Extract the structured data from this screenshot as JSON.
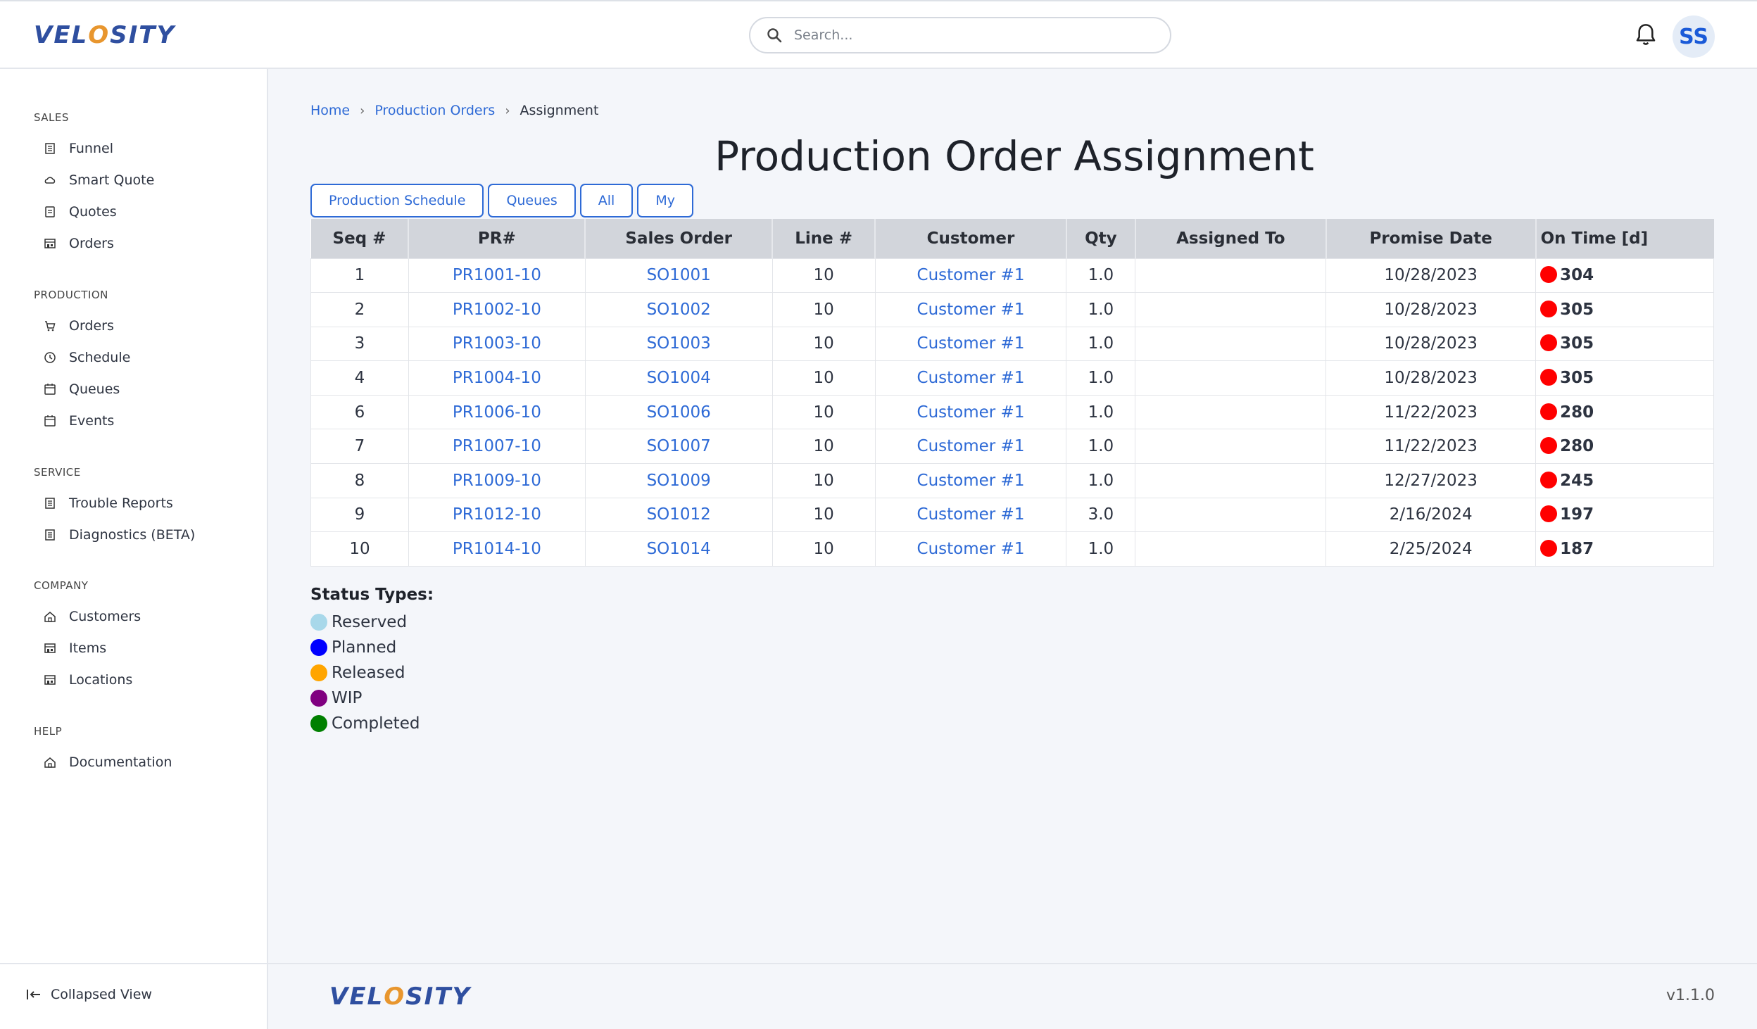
{
  "header": {
    "logo_text_a": "VEL",
    "logo_text_o": "O",
    "logo_text_b": "SITY",
    "search_placeholder": "Search...",
    "avatar_initials": "SS"
  },
  "sidebar": {
    "sections": [
      {
        "title": "SALES",
        "items": [
          {
            "label": "Funnel",
            "icon": "building-icon"
          },
          {
            "label": "Smart Quote",
            "icon": "cloud-icon"
          },
          {
            "label": "Quotes",
            "icon": "document-icon"
          },
          {
            "label": "Orders",
            "icon": "store-icon"
          }
        ]
      },
      {
        "title": "PRODUCTION",
        "items": [
          {
            "label": "Orders",
            "icon": "cart-icon"
          },
          {
            "label": "Schedule",
            "icon": "clock-icon"
          },
          {
            "label": "Queues",
            "icon": "calendar-icon"
          },
          {
            "label": "Events",
            "icon": "calendar-icon"
          }
        ]
      },
      {
        "title": "SERVICE",
        "items": [
          {
            "label": "Trouble Reports",
            "icon": "building-icon"
          },
          {
            "label": "Diagnostics (BETA)",
            "icon": "building-icon"
          }
        ]
      },
      {
        "title": "COMPANY",
        "items": [
          {
            "label": "Customers",
            "icon": "home-icon"
          },
          {
            "label": "Items",
            "icon": "store-icon"
          },
          {
            "label": "Locations",
            "icon": "store-icon"
          }
        ]
      },
      {
        "title": "HELP",
        "items": [
          {
            "label": "Documentation",
            "icon": "home-icon"
          }
        ]
      }
    ],
    "collapse_label": "Collapsed View"
  },
  "breadcrumb": {
    "home": "Home",
    "parent": "Production Orders",
    "current": "Assignment"
  },
  "page_title": "Production Order Assignment",
  "buttons": {
    "schedule": "Production Schedule",
    "queues": "Queues",
    "all": "All",
    "my": "My"
  },
  "table": {
    "headers": [
      "Seq #",
      "PR#",
      "Sales Order",
      "Line #",
      "Customer",
      "Qty",
      "Assigned To",
      "Promise Date",
      "On Time [d]"
    ],
    "rows": [
      {
        "seq": "1",
        "pr": "PR1001-10",
        "so": "SO1001",
        "line": "10",
        "customer": "Customer #1",
        "qty": "1.0",
        "assigned": "",
        "date": "10/28/2023",
        "ontime": "304"
      },
      {
        "seq": "2",
        "pr": "PR1002-10",
        "so": "SO1002",
        "line": "10",
        "customer": "Customer #1",
        "qty": "1.0",
        "assigned": "",
        "date": "10/28/2023",
        "ontime": "305"
      },
      {
        "seq": "3",
        "pr": "PR1003-10",
        "so": "SO1003",
        "line": "10",
        "customer": "Customer #1",
        "qty": "1.0",
        "assigned": "",
        "date": "10/28/2023",
        "ontime": "305"
      },
      {
        "seq": "4",
        "pr": "PR1004-10",
        "so": "SO1004",
        "line": "10",
        "customer": "Customer #1",
        "qty": "1.0",
        "assigned": "",
        "date": "10/28/2023",
        "ontime": "305"
      },
      {
        "seq": "6",
        "pr": "PR1006-10",
        "so": "SO1006",
        "line": "10",
        "customer": "Customer #1",
        "qty": "1.0",
        "assigned": "",
        "date": "11/22/2023",
        "ontime": "280"
      },
      {
        "seq": "7",
        "pr": "PR1007-10",
        "so": "SO1007",
        "line": "10",
        "customer": "Customer #1",
        "qty": "1.0",
        "assigned": "",
        "date": "11/22/2023",
        "ontime": "280"
      },
      {
        "seq": "8",
        "pr": "PR1009-10",
        "so": "SO1009",
        "line": "10",
        "customer": "Customer #1",
        "qty": "1.0",
        "assigned": "",
        "date": "12/27/2023",
        "ontime": "245"
      },
      {
        "seq": "9",
        "pr": "PR1012-10",
        "so": "SO1012",
        "line": "10",
        "customer": "Customer #1",
        "qty": "3.0",
        "assigned": "",
        "date": "2/16/2024",
        "ontime": "197"
      },
      {
        "seq": "10",
        "pr": "PR1014-10",
        "so": "SO1014",
        "line": "10",
        "customer": "Customer #1",
        "qty": "1.0",
        "assigned": "",
        "date": "2/25/2024",
        "ontime": "187"
      }
    ],
    "ontime_color": "#ff0000"
  },
  "status": {
    "title": "Status Types:",
    "types": [
      {
        "label": "Reserved",
        "color": "#a8d8ea"
      },
      {
        "label": "Planned",
        "color": "#0000ff"
      },
      {
        "label": "Released",
        "color": "#ffa500"
      },
      {
        "label": "WIP",
        "color": "#800080"
      },
      {
        "label": "Completed",
        "color": "#008000"
      }
    ]
  },
  "footer": {
    "version": "v1.1.0"
  }
}
